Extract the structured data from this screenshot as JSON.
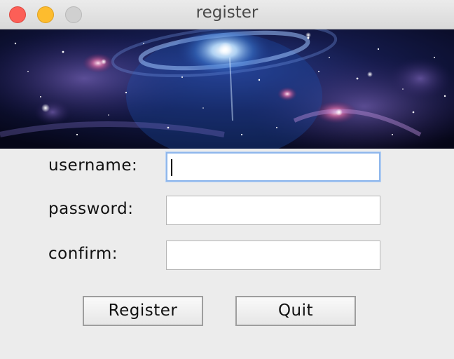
{
  "window": {
    "title": "register"
  },
  "form": {
    "username_label": "username:",
    "password_label": "password:",
    "confirm_label": "confirm:",
    "username_value": "",
    "password_value": "",
    "confirm_value": ""
  },
  "buttons": {
    "register_label": "Register",
    "quit_label": "Quit"
  }
}
